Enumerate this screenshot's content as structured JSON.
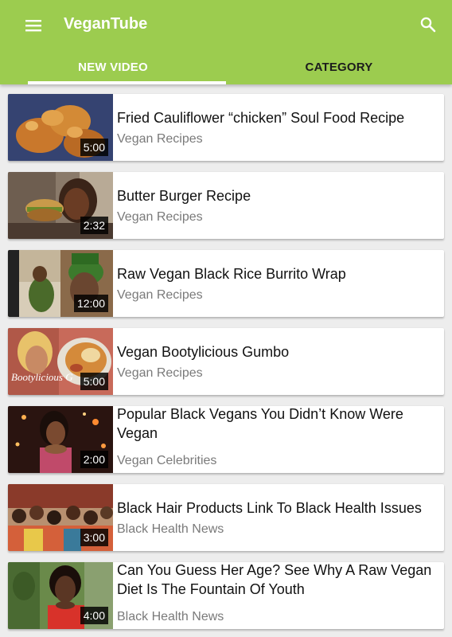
{
  "app": {
    "title": "VeganTube",
    "brand_color": "#9ccc4f"
  },
  "tabs": [
    {
      "label": "NEW VIDEO",
      "selected": true
    },
    {
      "label": "CATEGORY",
      "selected": false
    }
  ],
  "icons": {
    "menu": "menu-icon",
    "search": "search-icon"
  },
  "videos": [
    {
      "title": "Fried Cauliflower “chicken” Soul Food Recipe",
      "category": "Vegan Recipes",
      "duration": "5:00"
    },
    {
      "title": "Butter Burger Recipe",
      "category": "Vegan Recipes",
      "duration": "2:32"
    },
    {
      "title": "Raw Vegan  Black Rice Burrito Wrap",
      "category": "Vegan Recipes",
      "duration": "12:00"
    },
    {
      "title": "Vegan Bootylicious Gumbo",
      "category": "Vegan Recipes",
      "duration": "5:00",
      "thumb_text": "Bootylicious G"
    },
    {
      "title": "Popular Black Vegans You Didn’t Know Were Vegan",
      "category": "Vegan Celebrities",
      "duration": "2:00"
    },
    {
      "title": "Black Hair Products Link To Black Health Issues",
      "category": "Black Health News",
      "duration": "3:00"
    },
    {
      "title": "Can You Guess Her Age? See Why A Raw Vegan Diet Is The Fountain Of Youth",
      "category": "Black Health News",
      "duration": "4:00"
    }
  ]
}
